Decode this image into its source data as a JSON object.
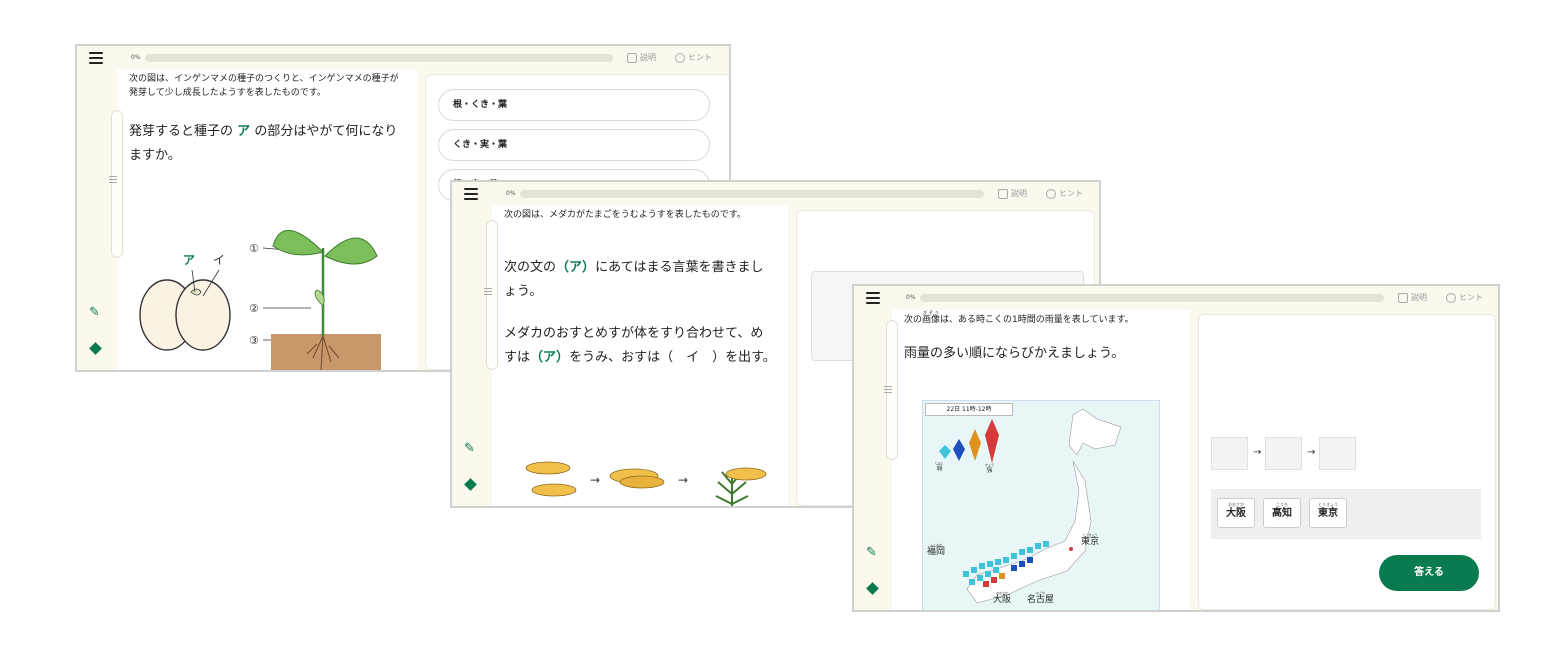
{
  "screen1": {
    "progress_label": "0%",
    "progress_value": 0,
    "explain_label": "説明",
    "hint_label": "ヒント",
    "lead": "次の図は、インゲンマメの種子のつくりと、インゲンマメの種子が発芽して少し成長したようすを表したものです。",
    "question_pre": "発芽すると種子の",
    "question_mark": "ア",
    "question_post": "の部分はやがて何になりますか。",
    "figure": {
      "seed_label_a": "ア",
      "seed_label_i": "イ",
      "num1": "①",
      "num2": "②",
      "num3": "③"
    },
    "choices": [
      "根・くき・葉",
      "くき・実・葉",
      "根・実・葉"
    ]
  },
  "screen2": {
    "progress_label": "0%",
    "progress_value": 0,
    "explain_label": "説明",
    "hint_label": "ヒント",
    "lead": "次の図は、メダカがたまごをうむようすを表したものです。",
    "instruction_pre": "次の文の",
    "paren_open": "（",
    "instruction_mark": "ア",
    "paren_close": "）",
    "instruction_post": "にあてはまる言葉を書きましょう。",
    "sentence_1": "メダカのおすとめすが体をすり合わせて、めすは",
    "sentence_mark_a": "ア",
    "sentence_2": "をうみ、おすは（　イ　）を出す。"
  },
  "screen3": {
    "progress_label": "0%",
    "progress_value": 0,
    "explain_label": "説明",
    "hint_label": "ヒント",
    "lead_pre": "次の",
    "lead_ruby": "がぞう",
    "lead_word": "画像",
    "lead_post": "は、ある時こくの1時間の雨量を表しています。",
    "question": "雨量の多い順にならびかえましょう。",
    "map": {
      "time_label": "22日 11時-12時",
      "legend_weak_ruby": "じゃく",
      "legend_weak": "弱",
      "legend_strong_ruby": "きょう",
      "legend_strong": "強",
      "city_tokyo_ruby": "とうきょう",
      "city_tokyo": "東京",
      "city_fukuoka_ruby": "ふくおか",
      "city_fukuoka": "福岡",
      "city_osaka_ruby": "おおさか",
      "city_osaka": "大阪",
      "city_nagoya_ruby": "なごや",
      "city_nagoya": "名古屋"
    },
    "arrow": "→",
    "cards": [
      {
        "ruby": "おおさか",
        "word": "大阪"
      },
      {
        "ruby": "こうち",
        "word": "高知"
      },
      {
        "ruby": "とうきょう",
        "word": "東京"
      }
    ],
    "answer_label": "答える"
  },
  "colors": {
    "accent": "#0a7b4f",
    "background": "#fbf8ee",
    "border": "#cfd0cf"
  }
}
